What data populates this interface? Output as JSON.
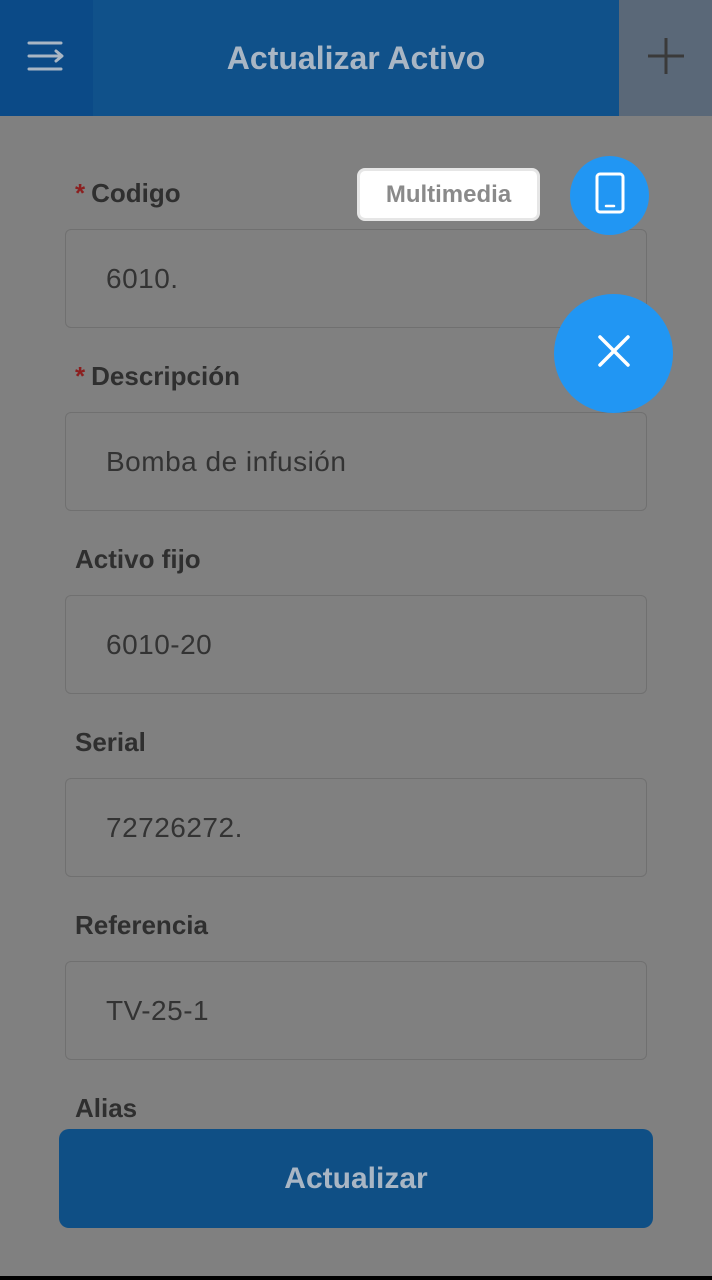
{
  "header": {
    "title": "Actualizar Activo",
    "menu_icon": "menu-icon",
    "add_icon": "plus-icon"
  },
  "fields": {
    "codigo": {
      "label": "Codigo",
      "required_mark": "*",
      "value": "6010."
    },
    "descripcion": {
      "label": "Descripción",
      "required_mark": "*",
      "value": "Bomba de infusión"
    },
    "activo_fijo": {
      "label": "Activo fijo",
      "value": "6010-20"
    },
    "serial": {
      "label": "Serial",
      "value": "72726272."
    },
    "referencia": {
      "label": "Referencia",
      "value": "TV-25-1"
    },
    "alias": {
      "label": "Alias"
    }
  },
  "fab_menu": {
    "multimedia_label": "Multimedia",
    "multimedia_icon": "tablet-icon",
    "close_icon": "close-icon"
  },
  "actions": {
    "submit_label": "Actualizar"
  },
  "colors": {
    "header": "#10518a",
    "fab": "#2196f3",
    "overlay": "#808080",
    "submit": "#0f4f85"
  }
}
